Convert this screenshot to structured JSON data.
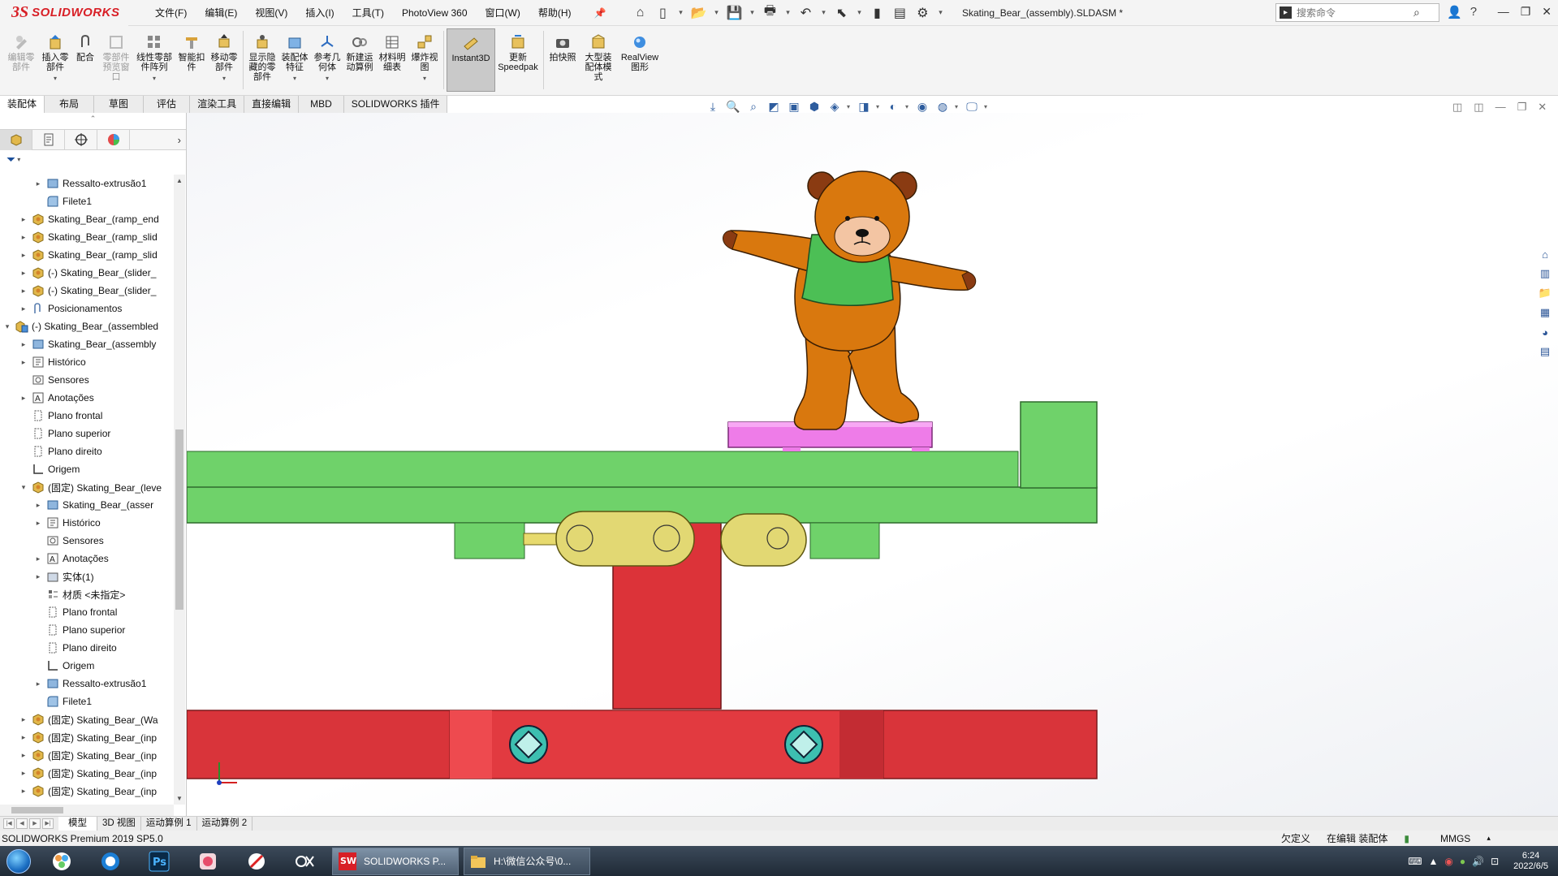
{
  "app": {
    "brand_ds": "3S",
    "brand_name": "SOLIDWORKS",
    "document_title": "Skating_Bear_(assembly).SLDASM *",
    "search_placeholder": "搜索命令"
  },
  "menu": [
    "文件(F)",
    "编辑(E)",
    "视图(V)",
    "插入(I)",
    "工具(T)",
    "PhotoView 360",
    "窗口(W)",
    "帮助(H)"
  ],
  "commands": [
    {
      "label": "编辑零\n部件",
      "disabled": true
    },
    {
      "label": "插入零\n部件",
      "disabled": false
    },
    {
      "label": "配合",
      "disabled": false
    },
    {
      "label": "零部件\n预览窗\n口",
      "disabled": true
    },
    {
      "label": "线性零部\n件阵列",
      "disabled": false
    },
    {
      "label": "智能扣\n件",
      "disabled": false
    },
    {
      "label": "移动零\n部件",
      "disabled": false
    },
    {
      "label": "显示隐\n藏的零\n部件",
      "disabled": false
    },
    {
      "label": "装配体\n特征",
      "disabled": false
    },
    {
      "label": "参考几\n何体",
      "disabled": false
    },
    {
      "label": "新建运\n动算例",
      "disabled": false
    },
    {
      "label": "材料明\n细表",
      "disabled": false
    },
    {
      "label": "爆炸视\n图",
      "disabled": false
    },
    {
      "label": "Instant3D",
      "disabled": false,
      "active": true
    },
    {
      "label": "更新\nSpeedpak",
      "disabled": false
    },
    {
      "label": "拍快照",
      "disabled": false
    },
    {
      "label": "大型装\n配体模\n式",
      "disabled": false
    },
    {
      "label": "RealView\n图形",
      "disabled": false
    }
  ],
  "tabs": [
    "装配体",
    "布局",
    "草图",
    "评估",
    "渲染工具",
    "直接编辑",
    "MBD",
    "SOLIDWORKS 插件"
  ],
  "tree": [
    {
      "label": "Ressalto-extrusão1",
      "level": 2,
      "exp": "▸",
      "icon": "extrude"
    },
    {
      "label": "Filete1",
      "level": 2,
      "exp": "",
      "icon": "fillet"
    },
    {
      "label": "Skating_Bear_(ramp_end",
      "level": 1,
      "exp": "▸",
      "icon": "part"
    },
    {
      "label": "Skating_Bear_(ramp_slid",
      "level": 1,
      "exp": "▸",
      "icon": "part"
    },
    {
      "label": "Skating_Bear_(ramp_slid",
      "level": 1,
      "exp": "▸",
      "icon": "part"
    },
    {
      "label": "(-) Skating_Bear_(slider_",
      "level": 1,
      "exp": "▸",
      "icon": "part"
    },
    {
      "label": "(-) Skating_Bear_(slider_",
      "level": 1,
      "exp": "▸",
      "icon": "part"
    },
    {
      "label": "Posicionamentos",
      "level": 1,
      "exp": "▸",
      "icon": "mates"
    },
    {
      "label": "(-) Skating_Bear_(assembled",
      "level": 0,
      "exp": "▾",
      "icon": "assembly"
    },
    {
      "label": "Skating_Bear_(assembly",
      "level": 1,
      "exp": "▸",
      "icon": "extrude"
    },
    {
      "label": "Histórico",
      "level": 1,
      "exp": "▸",
      "icon": "history"
    },
    {
      "label": "Sensores",
      "level": 1,
      "exp": "",
      "icon": "sensor"
    },
    {
      "label": "Anotações",
      "level": 1,
      "exp": "▸",
      "icon": "annot"
    },
    {
      "label": "Plano frontal",
      "level": 1,
      "exp": "",
      "icon": "plane"
    },
    {
      "label": "Plano superior",
      "level": 1,
      "exp": "",
      "icon": "plane"
    },
    {
      "label": "Plano direito",
      "level": 1,
      "exp": "",
      "icon": "plane"
    },
    {
      "label": "Origem",
      "level": 1,
      "exp": "",
      "icon": "origin"
    },
    {
      "label": "(固定) Skating_Bear_(leve",
      "level": 1,
      "exp": "▾",
      "icon": "part"
    },
    {
      "label": "Skating_Bear_(asser",
      "level": 2,
      "exp": "▸",
      "icon": "extrude"
    },
    {
      "label": "Histórico",
      "level": 2,
      "exp": "▸",
      "icon": "history"
    },
    {
      "label": "Sensores",
      "level": 2,
      "exp": "",
      "icon": "sensor"
    },
    {
      "label": "Anotações",
      "level": 2,
      "exp": "▸",
      "icon": "annot"
    },
    {
      "label": "实体(1)",
      "level": 2,
      "exp": "▸",
      "icon": "solid"
    },
    {
      "label": "材质 <未指定>",
      "level": 2,
      "exp": "",
      "icon": "material"
    },
    {
      "label": "Plano frontal",
      "level": 2,
      "exp": "",
      "icon": "plane"
    },
    {
      "label": "Plano superior",
      "level": 2,
      "exp": "",
      "icon": "plane"
    },
    {
      "label": "Plano direito",
      "level": 2,
      "exp": "",
      "icon": "plane"
    },
    {
      "label": "Origem",
      "level": 2,
      "exp": "",
      "icon": "origin"
    },
    {
      "label": "Ressalto-extrusão1",
      "level": 2,
      "exp": "▸",
      "icon": "extrude"
    },
    {
      "label": "Filete1",
      "level": 2,
      "exp": "",
      "icon": "fillet"
    },
    {
      "label": "(固定) Skating_Bear_(Wa",
      "level": 1,
      "exp": "▸",
      "icon": "part"
    },
    {
      "label": "(固定) Skating_Bear_(inp",
      "level": 1,
      "exp": "▸",
      "icon": "part"
    },
    {
      "label": "(固定) Skating_Bear_(inp",
      "level": 1,
      "exp": "▸",
      "icon": "part"
    },
    {
      "label": "(固定) Skating_Bear_(inp",
      "level": 1,
      "exp": "▸",
      "icon": "part"
    },
    {
      "label": "(固定) Skating_Bear_(inp",
      "level": 1,
      "exp": "▸",
      "icon": "part"
    }
  ],
  "bottom_tabs": [
    "模型",
    "3D 视图",
    "运动算例 1",
    "运动算例 2"
  ],
  "status": {
    "version": "SOLIDWORKS Premium 2019 SP5.0",
    "underdefined": "欠定义",
    "editing": "在编辑 装配体",
    "units": "MMGS"
  },
  "taskbar": {
    "windows": [
      {
        "label": "SOLIDWORKS P...",
        "badge": "2019",
        "active": true
      },
      {
        "label": "H:\\微信公众号\\0...",
        "active": false
      }
    ],
    "time": "6:24",
    "date": "2022/6/5"
  },
  "colors": {
    "brand_red": "#d81f26",
    "bear_orange": "#d9780e",
    "shirt_green": "#4cbf55",
    "board_pink": "#ee7ce8",
    "lever_green": "#6fd26a",
    "base_red": "#dc3339",
    "link_yellow": "#e2d873",
    "screw_teal": "#3dbfb0"
  }
}
